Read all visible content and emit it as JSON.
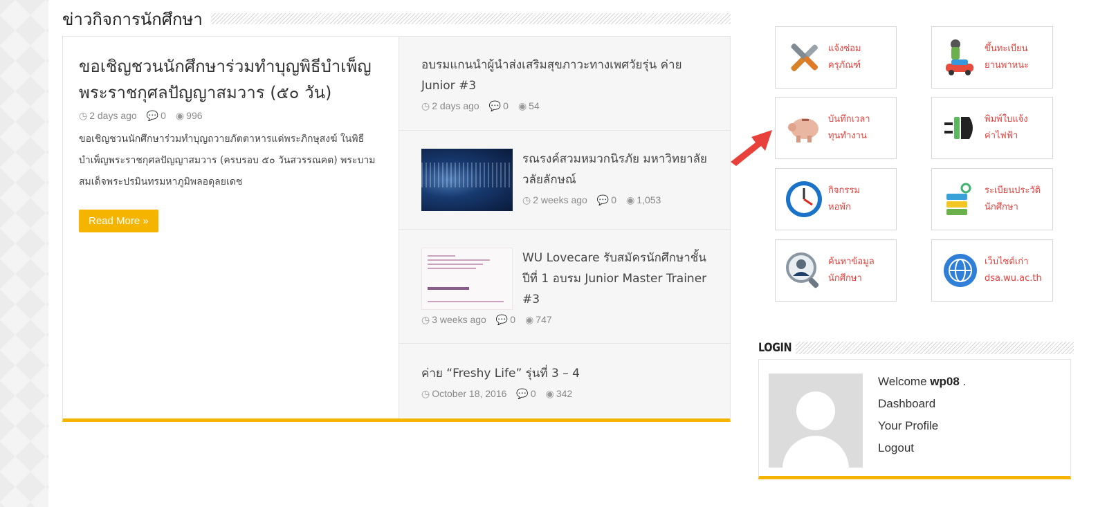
{
  "news": {
    "section_title": "ข่าวกิจการนักศึกษา",
    "featured": {
      "title": "ขอเชิญชวนนักศึกษาร่วมทำบุญพิธีบำเพ็ญพระราชกุศลปัญญาสมวาร (๕๐ วัน)",
      "date": "2 days ago",
      "comments": "0",
      "views": "996",
      "excerpt": "ขอเชิญชวนนักศึกษาร่วมทำบุญถวายภัตตาหารแด่พระภิกษุสงฆ์ ในพิธีบำเพ็ญพระราชกุศลปัญญาสมวาร (ครบรอบ ๕๐ วันสวรรณคต) พระบามสมเด็จพระปรมินทรมหาภูมิพลอดุลยเดช",
      "read_more": "Read More »"
    },
    "items": [
      {
        "title": "อบรมแกนนำผู้นำส่งเสริมสุขภาวะทางเพศวัยรุ่น ค่าย Junior #3",
        "date": "2 days ago",
        "comments": "0",
        "views": "54"
      },
      {
        "title": "รณรงค์สวมหมวกนิรภัย มหาวิทยาลัยวลัยลักษณ์",
        "date": "2 weeks ago",
        "comments": "0",
        "views": "1,053"
      },
      {
        "title": "WU Lovecare รับสมัครนักศึกษาชั้นปีที่ 1 อบรม Junior Master Trainer #3",
        "date": "3 weeks ago",
        "comments": "0",
        "views": "747"
      },
      {
        "title": "ค่าย “Freshy Life” รุ่นที่ 3 – 4",
        "date": "October 18, 2016",
        "comments": "0",
        "views": "342"
      }
    ]
  },
  "quick_links": [
    {
      "line1": "แจ้งซ่อม",
      "line2": "ครุภัณฑ์",
      "icon": "tools-icon"
    },
    {
      "line1": "ขึ้นทะเบียน",
      "line2": "ยานพาหนะ",
      "icon": "vehicle-icon"
    },
    {
      "line1": "บันทึกเวลา",
      "line2": "ทุนทำงาน",
      "icon": "piggy-bank-icon"
    },
    {
      "line1": "พิมพ์ใบแจ้ง",
      "line2": "ค่าไฟฟ้า",
      "icon": "plug-icon"
    },
    {
      "line1": "กิจกรรม",
      "line2": "หอพัก",
      "icon": "clock-icon"
    },
    {
      "line1": "ระเบียนประวัติ",
      "line2": "นักศึกษา",
      "icon": "records-icon"
    },
    {
      "line1": "ค้นหาข้อมูล",
      "line2": "นักศึกษา",
      "icon": "search-person-icon"
    },
    {
      "line1": "เว็บไซต์เก่า",
      "line2": "dsa.wu.ac.th",
      "icon": "globe-icon"
    }
  ],
  "login": {
    "title": "LOGIN",
    "welcome_prefix": "Welcome ",
    "username": "wp08",
    "welcome_suffix": " .",
    "links": [
      "Dashboard",
      "Your Profile",
      "Logout"
    ]
  },
  "colors": {
    "accent": "#f5b400",
    "tile_text": "#e2413c",
    "arrow": "#e8403a"
  }
}
